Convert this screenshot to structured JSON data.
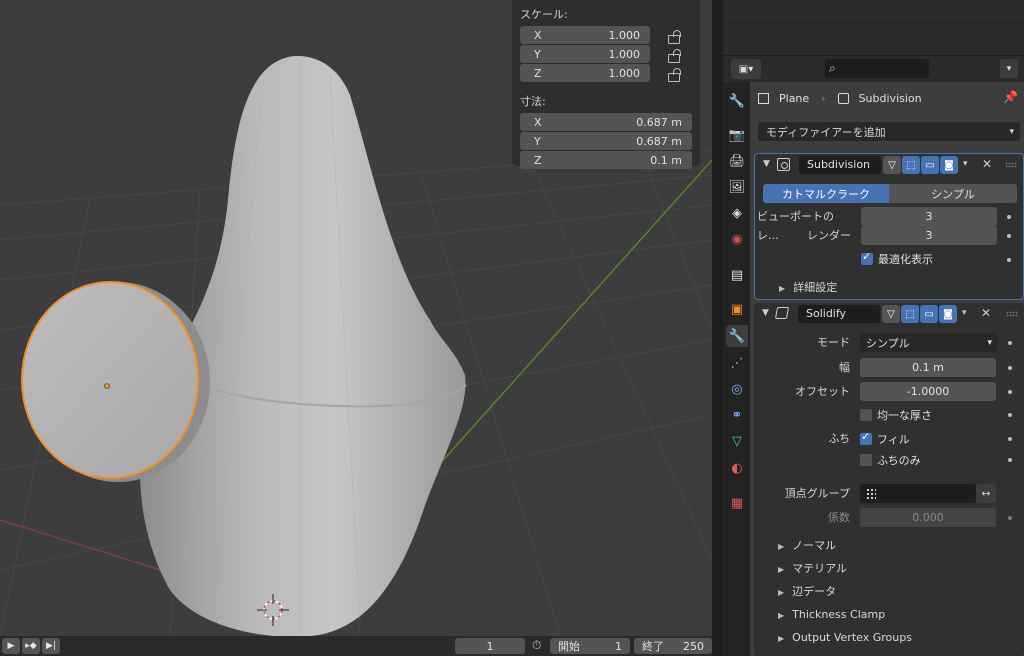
{
  "viewport_panel": {
    "scale_title": "スケール:",
    "scale": [
      {
        "axis": "X",
        "value": "1.000"
      },
      {
        "axis": "Y",
        "value": "1.000"
      },
      {
        "axis": "Z",
        "value": "1.000"
      }
    ],
    "dimensions_title": "寸法:",
    "dimensions": [
      {
        "axis": "X",
        "value": "0.687 m"
      },
      {
        "axis": "Y",
        "value": "0.687 m"
      },
      {
        "axis": "Z",
        "value": "0.1 m"
      }
    ]
  },
  "timeline": {
    "current_frame": "1",
    "start_label": "開始",
    "start": "1",
    "end_label": "終了",
    "end": "250"
  },
  "header": {
    "search_icon": "search-icon"
  },
  "breadcrumb": {
    "object": "Plane",
    "modifier": "Subdivision"
  },
  "add_modifier": "モディファイアーを追加",
  "subdivision": {
    "name": "Subdivision",
    "mode_a": "カトマルクラーク",
    "mode_b": "シンプル",
    "viewport_label": "ビューポートのレ...",
    "viewport_value": "3",
    "render_label": "レンダー",
    "render_value": "3",
    "optimal_label": "最適化表示",
    "advanced_label": "詳細設定"
  },
  "solidify": {
    "name": "Solidify",
    "mode_label": "モード",
    "mode_value": "シンプル",
    "thickness_label": "幅",
    "thickness_value": "0.1 m",
    "offset_label": "オフセット",
    "offset_value": "-1.0000",
    "even_label": "均一な厚さ",
    "rim_label": "ふち",
    "fill_label": "フィル",
    "rim_only_label": "ふちのみ",
    "vgroup_label": "頂点グループ",
    "factor_label": "係数",
    "factor_value": "0.000",
    "subpanels": [
      "ノーマル",
      "マテリアル",
      "辺データ",
      "Thickness Clamp",
      "Output Vertex Groups"
    ]
  },
  "colors": {
    "accent": "#4772b3",
    "selection_outline": "#f0902a",
    "viewport_bg": "#3d3d3d"
  }
}
